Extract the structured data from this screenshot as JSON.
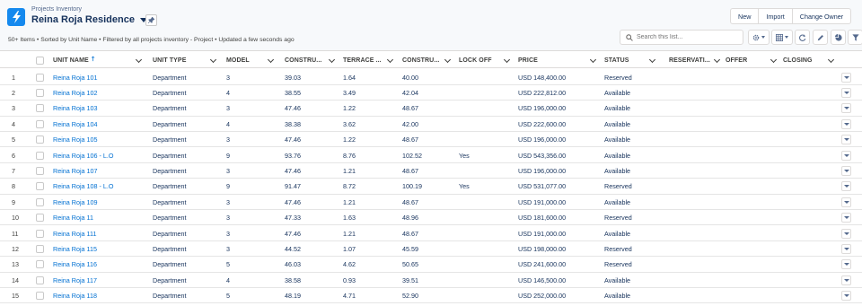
{
  "header": {
    "object_label": "Projects Inventory",
    "list_name": "Reina Roja Residence",
    "summary": "50+ Items • Sorted by Unit Name • Filtered by all projects inventory - Project • Updated a few seconds ago",
    "buttons": {
      "new": "New",
      "import": "Import",
      "change_owner": "Change Owner"
    },
    "search_placeholder": "Search this list..."
  },
  "columns": {
    "unit_name": "UNIT NAME",
    "unit_type": "UNIT TYPE",
    "model": "MODEL",
    "construction_1": "CONSTRU...",
    "terrace": "TERRACE ...",
    "construction_2": "CONSTRU...",
    "lock_off": "LOCK OFF",
    "price": "PRICE",
    "status": "STATUS",
    "reservation": "RESERVATI...",
    "offer": "OFFER",
    "closing": "CLOSING"
  },
  "rows": [
    {
      "n": "1",
      "name": "Reina Roja 101",
      "type": "Department",
      "model": "3",
      "c1": "39.03",
      "terrace": "1.64",
      "c2": "40.00",
      "lock": "",
      "price": "USD 148,400.00",
      "status": "Reserved"
    },
    {
      "n": "2",
      "name": "Reina Roja 102",
      "type": "Department",
      "model": "4",
      "c1": "38.55",
      "terrace": "3.49",
      "c2": "42.04",
      "lock": "",
      "price": "USD 222,812.00",
      "status": "Available"
    },
    {
      "n": "3",
      "name": "Reina Roja 103",
      "type": "Department",
      "model": "3",
      "c1": "47.46",
      "terrace": "1.22",
      "c2": "48.67",
      "lock": "",
      "price": "USD 196,000.00",
      "status": "Available"
    },
    {
      "n": "4",
      "name": "Reina Roja 104",
      "type": "Department",
      "model": "4",
      "c1": "38.38",
      "terrace": "3.62",
      "c2": "42.00",
      "lock": "",
      "price": "USD 222,600.00",
      "status": "Available"
    },
    {
      "n": "5",
      "name": "Reina Roja 105",
      "type": "Department",
      "model": "3",
      "c1": "47.46",
      "terrace": "1.22",
      "c2": "48.67",
      "lock": "",
      "price": "USD 196,000.00",
      "status": "Available"
    },
    {
      "n": "6",
      "name": "Reina Roja 106 - L.O",
      "type": "Department",
      "model": "9",
      "c1": "93.76",
      "terrace": "8.76",
      "c2": "102.52",
      "lock": "Yes",
      "price": "USD 543,356.00",
      "status": "Available"
    },
    {
      "n": "7",
      "name": "Reina Roja 107",
      "type": "Department",
      "model": "3",
      "c1": "47.46",
      "terrace": "1.21",
      "c2": "48.67",
      "lock": "",
      "price": "USD 196,000.00",
      "status": "Available"
    },
    {
      "n": "8",
      "name": "Reina Roja 108 - L.O",
      "type": "Department",
      "model": "9",
      "c1": "91.47",
      "terrace": "8.72",
      "c2": "100.19",
      "lock": "Yes",
      "price": "USD 531,077.00",
      "status": "Reserved"
    },
    {
      "n": "9",
      "name": "Reina Roja 109",
      "type": "Department",
      "model": "3",
      "c1": "47.46",
      "terrace": "1.21",
      "c2": "48.67",
      "lock": "",
      "price": "USD 191,000.00",
      "status": "Available"
    },
    {
      "n": "10",
      "name": "Reina Roja 11",
      "type": "Department",
      "model": "3",
      "c1": "47.33",
      "terrace": "1.63",
      "c2": "48.96",
      "lock": "",
      "price": "USD 181,600.00",
      "status": "Reserved"
    },
    {
      "n": "11",
      "name": "Reina Roja 111",
      "type": "Department",
      "model": "3",
      "c1": "47.46",
      "terrace": "1.21",
      "c2": "48.67",
      "lock": "",
      "price": "USD 191,000.00",
      "status": "Available"
    },
    {
      "n": "12",
      "name": "Reina Roja 115",
      "type": "Department",
      "model": "3",
      "c1": "44.52",
      "terrace": "1.07",
      "c2": "45.59",
      "lock": "",
      "price": "USD 198,000.00",
      "status": "Reserved"
    },
    {
      "n": "13",
      "name": "Reina Roja 116",
      "type": "Department",
      "model": "5",
      "c1": "46.03",
      "terrace": "4.62",
      "c2": "50.65",
      "lock": "",
      "price": "USD 241,600.00",
      "status": "Reserved"
    },
    {
      "n": "14",
      "name": "Reina Roja 117",
      "type": "Department",
      "model": "4",
      "c1": "38.58",
      "terrace": "0.93",
      "c2": "39.51",
      "lock": "",
      "price": "USD 146,500.00",
      "status": "Available"
    },
    {
      "n": "15",
      "name": "Reina Roja 118",
      "type": "Department",
      "model": "5",
      "c1": "48.19",
      "terrace": "4.71",
      "c2": "52.90",
      "lock": "",
      "price": "USD 252,000.00",
      "status": "Available"
    }
  ]
}
